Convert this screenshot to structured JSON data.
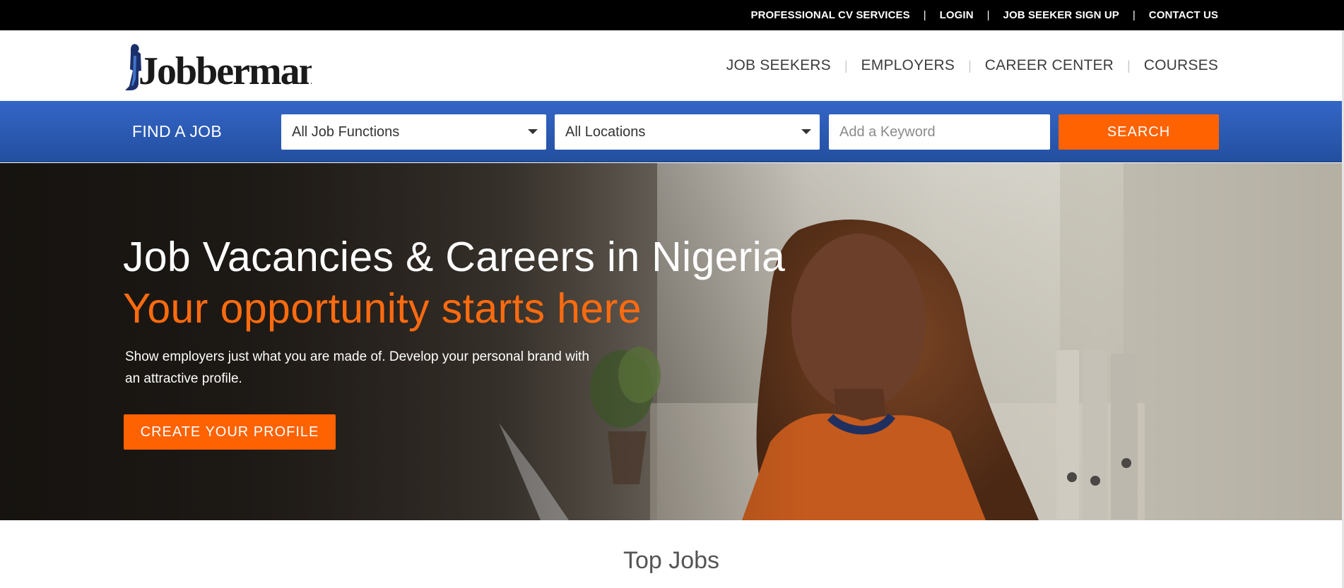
{
  "topbar": {
    "links": [
      "PROFESSIONAL CV SERVICES",
      "LOGIN",
      "JOB SEEKER SIGN UP",
      "CONTACT US"
    ],
    "separator": "|"
  },
  "brand": {
    "logo_text": "Jobberman"
  },
  "mainnav": {
    "items": [
      "JOB SEEKERS",
      "EMPLOYERS",
      "CAREER CENTER",
      "COURSES"
    ],
    "separator": "|"
  },
  "search": {
    "label": "FIND A JOB",
    "job_function": "All Job Functions",
    "location": "All Locations",
    "keyword_placeholder": "Add a Keyword",
    "button": "SEARCH"
  },
  "hero": {
    "title": "Job Vacancies & Careers in Nigeria",
    "tagline": "Your opportunity starts here",
    "description": "Show employers just what you are made of. Develop your personal brand with an attractive profile.",
    "cta": "CREATE YOUR PROFILE"
  },
  "sections": {
    "top_jobs_title": "Top Jobs"
  },
  "colors": {
    "accent": "#ff6200",
    "nav_blue": "#2e5fbf",
    "topbar": "#000000"
  },
  "icons": [
    "caret-down-icon",
    "jobberman-logo-figure-icon"
  ]
}
